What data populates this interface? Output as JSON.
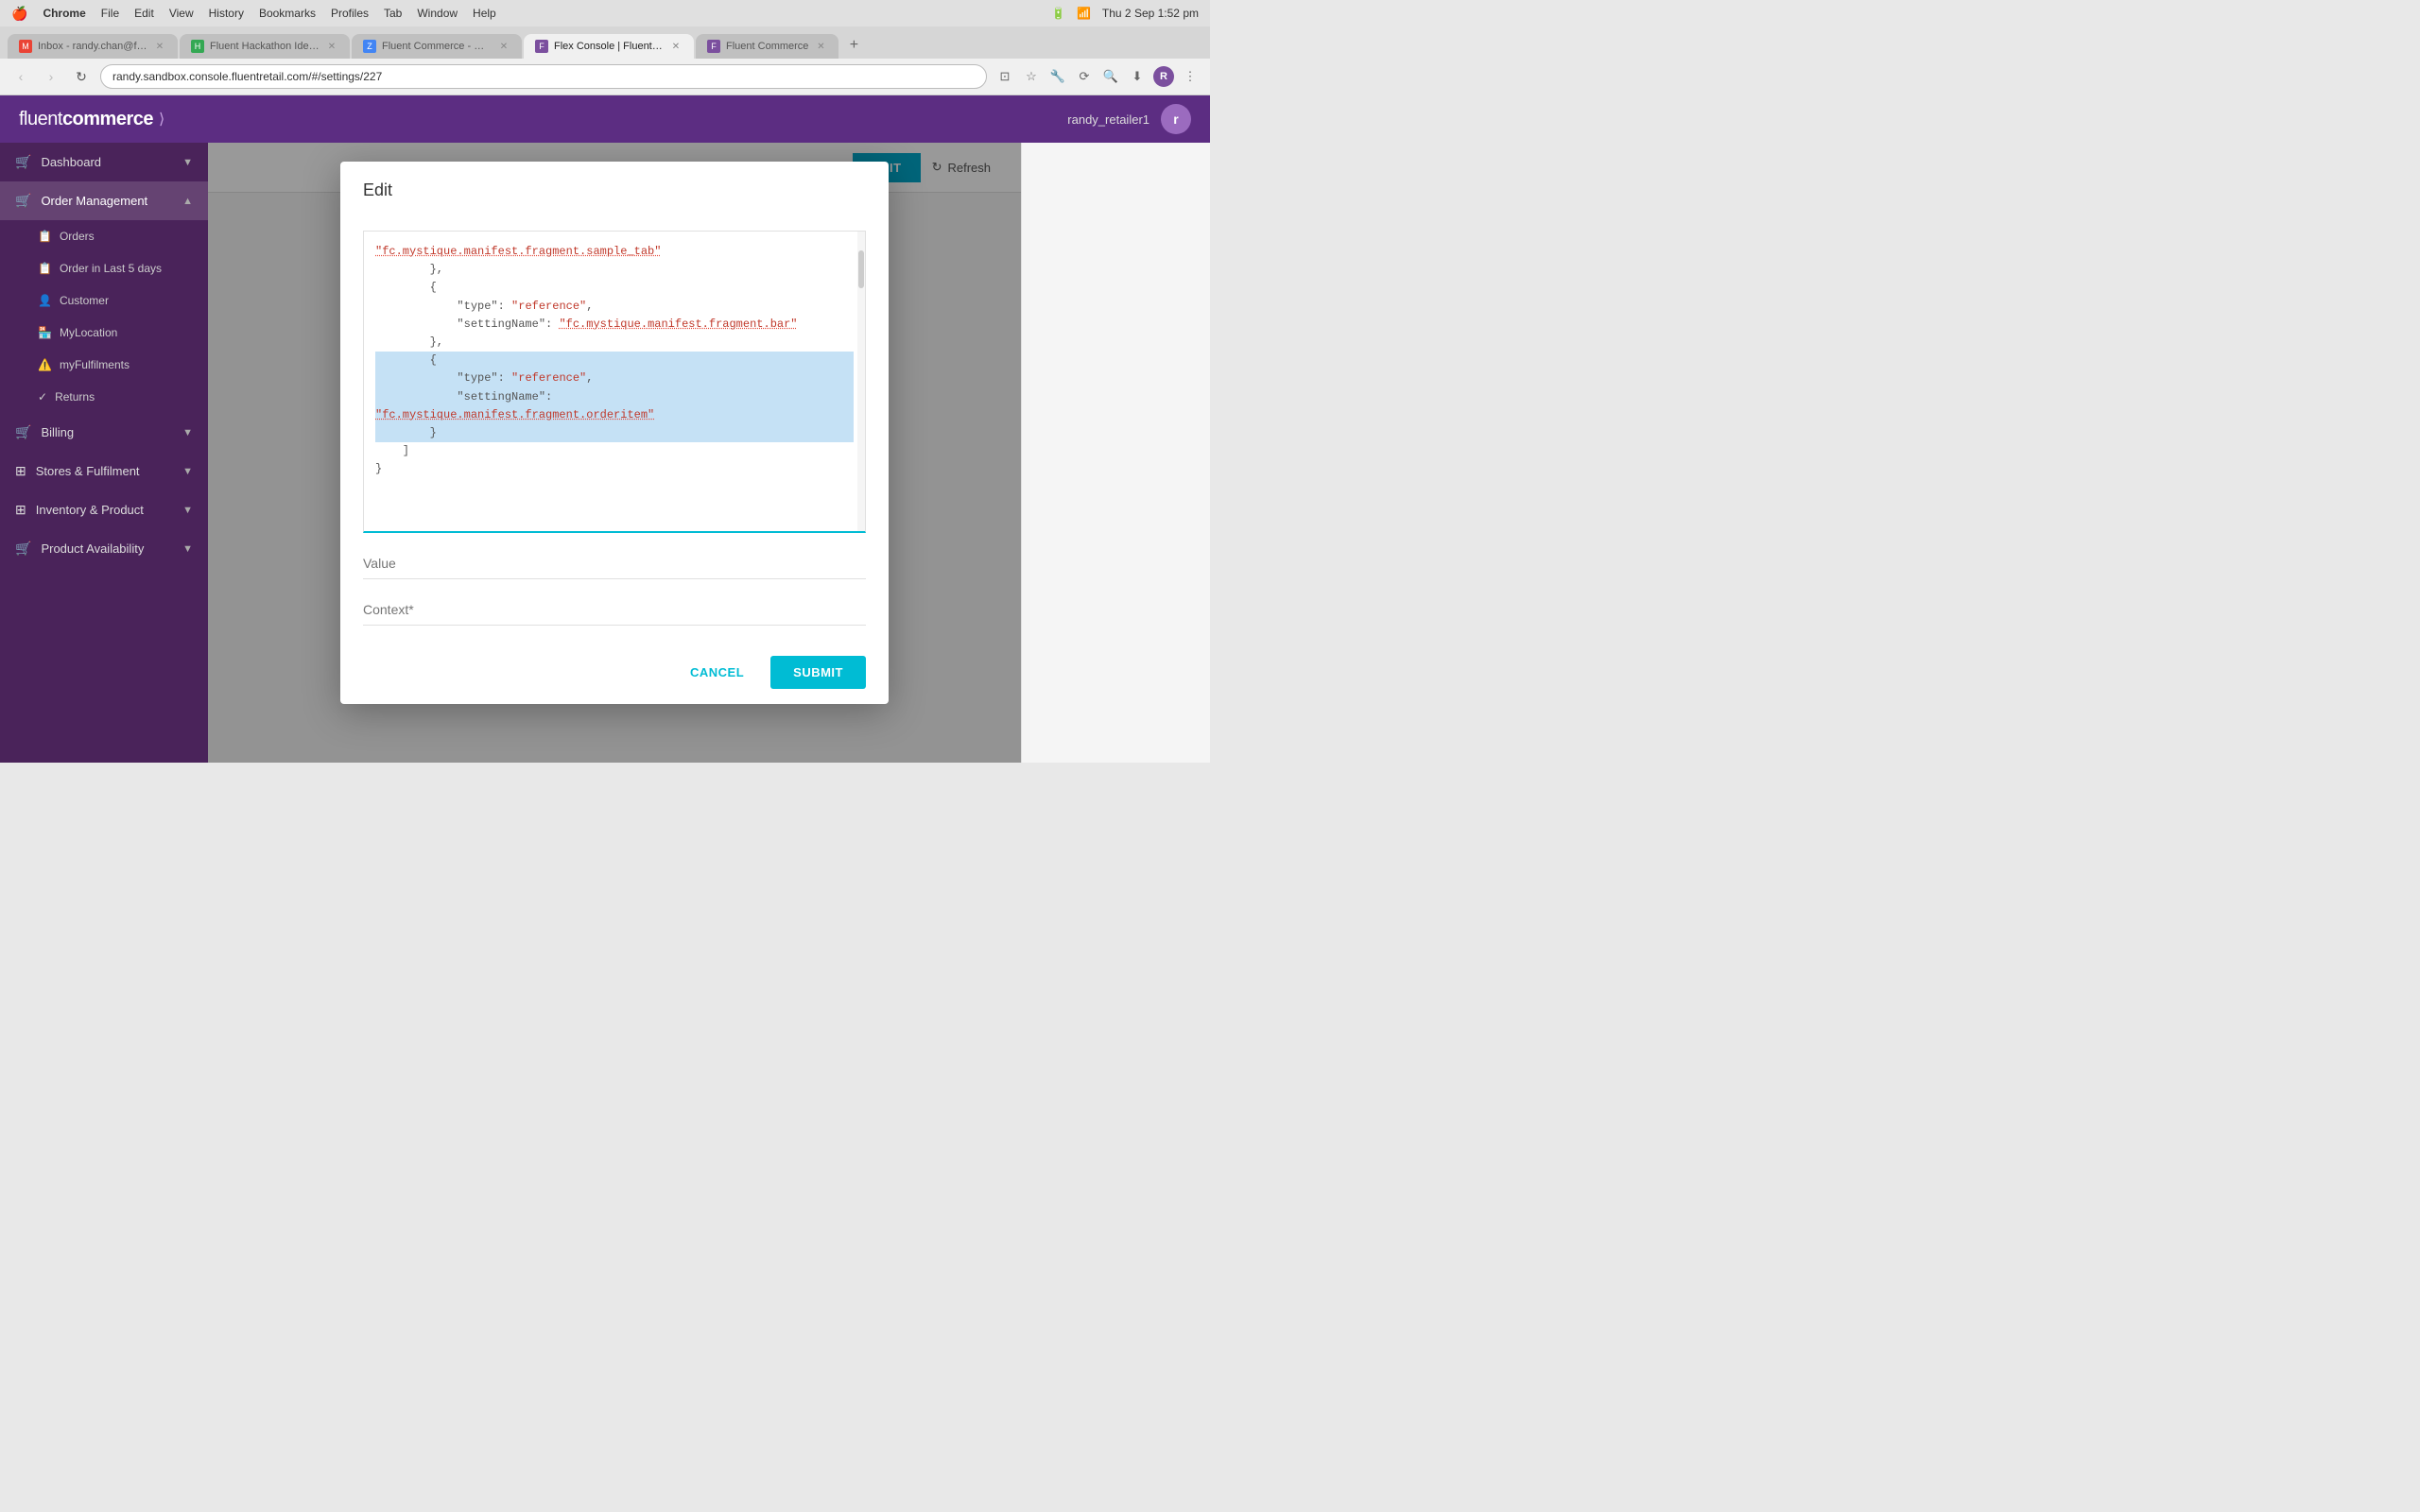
{
  "macbar": {
    "apple": "🍎",
    "menus": [
      "Chrome",
      "File",
      "Edit",
      "View",
      "History",
      "Bookmarks",
      "Profiles",
      "Tab",
      "Window",
      "Help"
    ],
    "time": "Thu 2 Sep  1:52 pm"
  },
  "browser": {
    "tabs": [
      {
        "id": "gmail",
        "label": "Inbox - randy.chan@fluen...",
        "favicon_color": "#EA4335",
        "active": false
      },
      {
        "id": "hackathon",
        "label": "Fluent Hackathon Ideas &...",
        "favicon_color": "#34A853",
        "active": false
      },
      {
        "id": "calendar",
        "label": "Fluent Commerce - Calen...",
        "favicon_color": "#4285F4",
        "active": false
      },
      {
        "id": "flex",
        "label": "Flex Console | Fluent Com...",
        "favicon_color": "#7b4f9e",
        "active": true
      },
      {
        "id": "fluent2",
        "label": "Fluent Commerce",
        "favicon_color": "#7b4f9e",
        "active": false
      }
    ],
    "address": "randy.sandbox.console.fluentretail.com/#/settings/227"
  },
  "app": {
    "logo_light": "fluent",
    "logo_bold": "commerce",
    "logo_arrow": "⟩",
    "username": "randy_retailer1",
    "avatar_letter": "r"
  },
  "sidebar": {
    "items": [
      {
        "id": "dashboard",
        "label": "Dashboard",
        "icon": "🛒",
        "chevron": "▼",
        "expanded": true
      },
      {
        "id": "order-management",
        "label": "Order Management",
        "icon": "🛒",
        "chevron": "▲",
        "expanded": true
      },
      {
        "id": "orders",
        "label": "Orders",
        "icon": "📋",
        "sub": true
      },
      {
        "id": "orders-last5",
        "label": "Order in Last 5 days",
        "icon": "📋",
        "sub": true
      },
      {
        "id": "customer",
        "label": "Customer",
        "icon": "👤",
        "sub": true
      },
      {
        "id": "mylocation",
        "label": "MyLocation",
        "icon": "🏪",
        "sub": true
      },
      {
        "id": "myfulfilments",
        "label": "myFulfilments",
        "icon": "⚠️",
        "sub": true
      },
      {
        "id": "returns",
        "label": "Returns",
        "icon": "✓",
        "sub": true
      },
      {
        "id": "billing",
        "label": "Billing",
        "icon": "🛒",
        "chevron": "▼",
        "expanded": false
      },
      {
        "id": "stores-fulfilment",
        "label": "Stores & Fulfilment",
        "icon": "⊞",
        "chevron": "▼",
        "expanded": false
      },
      {
        "id": "inventory-product",
        "label": "Inventory & Product",
        "icon": "⊞",
        "chevron": "▼",
        "expanded": false
      },
      {
        "id": "product-availability",
        "label": "Product Availability",
        "icon": "🛒",
        "chevron": "▼",
        "expanded": false
      }
    ]
  },
  "toolbar": {
    "edit_label": "EDIT",
    "refresh_label": "Refresh"
  },
  "modal": {
    "title": "Edit",
    "code_lines": [
      {
        "text": "\"fc.mystique.manifest.fragment.sample_tab\"",
        "type": "underline-string"
      },
      {
        "text": "        },"
      },
      {
        "text": "        {"
      },
      {
        "text": "            \"type\": \"reference\","
      },
      {
        "text": "            \"settingName\": \"fc.mystique.manifest.fragment.bar\"",
        "type": "underline-string"
      },
      {
        "text": "        },"
      },
      {
        "text": "        {",
        "selected": true
      },
      {
        "text": "            \"type\": \"reference\",",
        "selected": true
      },
      {
        "text": "            \"settingName\":",
        "selected": true
      },
      {
        "text": "\"fc.mystique.manifest.fragment.orderitem\"",
        "type": "underline-string",
        "selected": true
      },
      {
        "text": "        }",
        "selected": true
      },
      {
        "text": "    ]"
      },
      {
        "text": "}"
      }
    ],
    "value_placeholder": "Value",
    "context_placeholder": "Context*",
    "cancel_label": "CANCEL",
    "submit_label": "SUBMIT"
  }
}
